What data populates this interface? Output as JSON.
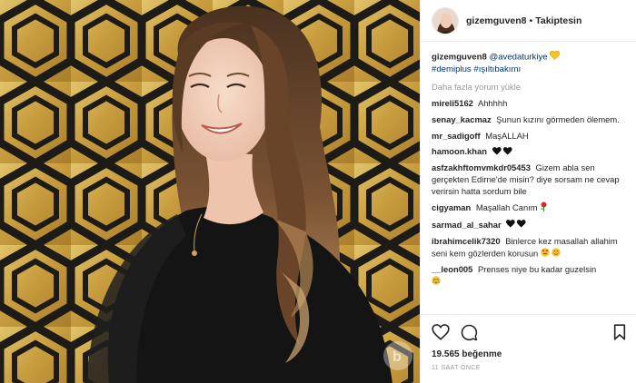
{
  "header": {
    "username": "gizemguven8",
    "separator": "•",
    "follow_status": "Takiptesin"
  },
  "caption": {
    "username": "gizemguven8",
    "mention": "@avedaturkiye",
    "hashtags": "#demiplus #ışıltıbakımı"
  },
  "load_more": "Daha fazla yorum yükle",
  "comments": [
    {
      "user": "mireli5162",
      "text": "Ahhhhh"
    },
    {
      "user": "senay_kacmaz",
      "text": "Şunun kızını görmeden ölemem."
    },
    {
      "user": "mr_sadigoff",
      "text": "MaşALLAH"
    },
    {
      "user": "hamoon.khan",
      "text": ""
    },
    {
      "user": "asfzakhftomvmkdr05453",
      "text": "Gizem abla sen gerçekten Edirne'de misin? diye sorsam ne cevap verirsin hatta sordum bile"
    },
    {
      "user": "cigyaman",
      "text": "Maşallah Canım"
    },
    {
      "user": "sarmad_al_sahar",
      "text": ""
    },
    {
      "user": "ibrahimcelik7320",
      "text": "Binlerce kez masallah allahim seni kem gözlerden korusun"
    },
    {
      "user": "__leon005",
      "text": "Prenses niye bu kadar guzelsin"
    }
  ],
  "likes": "19.565 beğenme",
  "timestamp": "11 SAAT ÖNCE",
  "icons": {
    "like": "heart-icon",
    "comment": "comment-bubble-icon",
    "save": "bookmark-icon",
    "heart_emoji": "yellow-heart-emoji",
    "black_hearts": "black-heart-emoji",
    "rose": "rose-emoji",
    "heart_eyes": "heart-eyes-emoji",
    "blush": "blush-emoji",
    "crying": "crying-emoji"
  },
  "colors": {
    "gold_wall": "#c9a44a",
    "lattice": "#1d1b17",
    "link": "#003569",
    "muted": "#999999"
  }
}
